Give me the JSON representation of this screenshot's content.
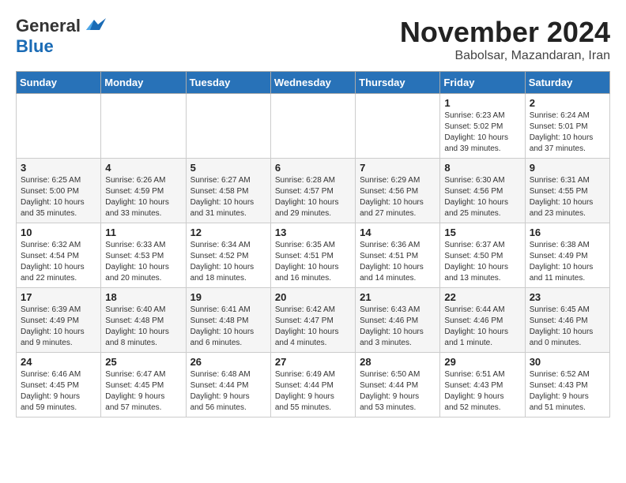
{
  "logo": {
    "general": "General",
    "blue": "Blue"
  },
  "header": {
    "month": "November 2024",
    "location": "Babolsar, Mazandaran, Iran"
  },
  "weekdays": [
    "Sunday",
    "Monday",
    "Tuesday",
    "Wednesday",
    "Thursday",
    "Friday",
    "Saturday"
  ],
  "weeks": [
    [
      {
        "day": "",
        "info": ""
      },
      {
        "day": "",
        "info": ""
      },
      {
        "day": "",
        "info": ""
      },
      {
        "day": "",
        "info": ""
      },
      {
        "day": "",
        "info": ""
      },
      {
        "day": "1",
        "info": "Sunrise: 6:23 AM\nSunset: 5:02 PM\nDaylight: 10 hours\nand 39 minutes."
      },
      {
        "day": "2",
        "info": "Sunrise: 6:24 AM\nSunset: 5:01 PM\nDaylight: 10 hours\nand 37 minutes."
      }
    ],
    [
      {
        "day": "3",
        "info": "Sunrise: 6:25 AM\nSunset: 5:00 PM\nDaylight: 10 hours\nand 35 minutes."
      },
      {
        "day": "4",
        "info": "Sunrise: 6:26 AM\nSunset: 4:59 PM\nDaylight: 10 hours\nand 33 minutes."
      },
      {
        "day": "5",
        "info": "Sunrise: 6:27 AM\nSunset: 4:58 PM\nDaylight: 10 hours\nand 31 minutes."
      },
      {
        "day": "6",
        "info": "Sunrise: 6:28 AM\nSunset: 4:57 PM\nDaylight: 10 hours\nand 29 minutes."
      },
      {
        "day": "7",
        "info": "Sunrise: 6:29 AM\nSunset: 4:56 PM\nDaylight: 10 hours\nand 27 minutes."
      },
      {
        "day": "8",
        "info": "Sunrise: 6:30 AM\nSunset: 4:56 PM\nDaylight: 10 hours\nand 25 minutes."
      },
      {
        "day": "9",
        "info": "Sunrise: 6:31 AM\nSunset: 4:55 PM\nDaylight: 10 hours\nand 23 minutes."
      }
    ],
    [
      {
        "day": "10",
        "info": "Sunrise: 6:32 AM\nSunset: 4:54 PM\nDaylight: 10 hours\nand 22 minutes."
      },
      {
        "day": "11",
        "info": "Sunrise: 6:33 AM\nSunset: 4:53 PM\nDaylight: 10 hours\nand 20 minutes."
      },
      {
        "day": "12",
        "info": "Sunrise: 6:34 AM\nSunset: 4:52 PM\nDaylight: 10 hours\nand 18 minutes."
      },
      {
        "day": "13",
        "info": "Sunrise: 6:35 AM\nSunset: 4:51 PM\nDaylight: 10 hours\nand 16 minutes."
      },
      {
        "day": "14",
        "info": "Sunrise: 6:36 AM\nSunset: 4:51 PM\nDaylight: 10 hours\nand 14 minutes."
      },
      {
        "day": "15",
        "info": "Sunrise: 6:37 AM\nSunset: 4:50 PM\nDaylight: 10 hours\nand 13 minutes."
      },
      {
        "day": "16",
        "info": "Sunrise: 6:38 AM\nSunset: 4:49 PM\nDaylight: 10 hours\nand 11 minutes."
      }
    ],
    [
      {
        "day": "17",
        "info": "Sunrise: 6:39 AM\nSunset: 4:49 PM\nDaylight: 10 hours\nand 9 minutes."
      },
      {
        "day": "18",
        "info": "Sunrise: 6:40 AM\nSunset: 4:48 PM\nDaylight: 10 hours\nand 8 minutes."
      },
      {
        "day": "19",
        "info": "Sunrise: 6:41 AM\nSunset: 4:48 PM\nDaylight: 10 hours\nand 6 minutes."
      },
      {
        "day": "20",
        "info": "Sunrise: 6:42 AM\nSunset: 4:47 PM\nDaylight: 10 hours\nand 4 minutes."
      },
      {
        "day": "21",
        "info": "Sunrise: 6:43 AM\nSunset: 4:46 PM\nDaylight: 10 hours\nand 3 minutes."
      },
      {
        "day": "22",
        "info": "Sunrise: 6:44 AM\nSunset: 4:46 PM\nDaylight: 10 hours\nand 1 minute."
      },
      {
        "day": "23",
        "info": "Sunrise: 6:45 AM\nSunset: 4:46 PM\nDaylight: 10 hours\nand 0 minutes."
      }
    ],
    [
      {
        "day": "24",
        "info": "Sunrise: 6:46 AM\nSunset: 4:45 PM\nDaylight: 9 hours\nand 59 minutes."
      },
      {
        "day": "25",
        "info": "Sunrise: 6:47 AM\nSunset: 4:45 PM\nDaylight: 9 hours\nand 57 minutes."
      },
      {
        "day": "26",
        "info": "Sunrise: 6:48 AM\nSunset: 4:44 PM\nDaylight: 9 hours\nand 56 minutes."
      },
      {
        "day": "27",
        "info": "Sunrise: 6:49 AM\nSunset: 4:44 PM\nDaylight: 9 hours\nand 55 minutes."
      },
      {
        "day": "28",
        "info": "Sunrise: 6:50 AM\nSunset: 4:44 PM\nDaylight: 9 hours\nand 53 minutes."
      },
      {
        "day": "29",
        "info": "Sunrise: 6:51 AM\nSunset: 4:43 PM\nDaylight: 9 hours\nand 52 minutes."
      },
      {
        "day": "30",
        "info": "Sunrise: 6:52 AM\nSunset: 4:43 PM\nDaylight: 9 hours\nand 51 minutes."
      }
    ]
  ]
}
